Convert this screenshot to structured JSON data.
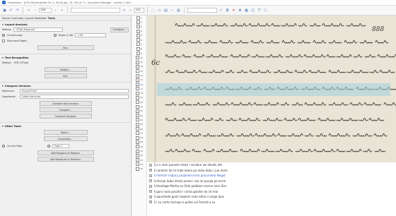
{
  "window": {
    "title": "Transkribus - [UTG-56] Kartoteka 50 / s. 56-lbi.jpg - 01 / 56 (nr 7) - Document Manager - version 1.18.0"
  },
  "toolbar": {
    "page_label": "1/56",
    "zoom": "100"
  },
  "left_panel": {
    "header": "Server Overview, Layout Metadata",
    "header_bold": "Tools",
    "layout": {
      "title": "Layout Analysis",
      "method_label": "Method:",
      "method_value": "CITlab Advanced",
      "config_button": "Configure...",
      "current_page_label": "Current page",
      "pages_label": "Pages (1-56)",
      "pages_value": "1-56",
      "document_label": "Document Pages",
      "run_button": "Run"
    },
    "text_recognition": {
      "title": "Text Recognition",
      "method_label": "Method:",
      "method_value": "HTR (CITlab)",
      "models_button": "Models...",
      "run_button": "Run"
    },
    "compare": {
      "title": "Compare Versions",
      "reference_label": "Reference:",
      "reference_value": "Ground Truth",
      "hypothesis_label": "Hypothesis:",
      "hypothesis_value": "Latest transcript",
      "compare_button": "Compare text versions",
      "advanced_button": "Compare...",
      "samples_button": "Compare Samples"
    },
    "other": {
      "title": "Other Tools",
      "unknown_button": "Tables...",
      "dup_button": "Duplicates...",
      "scope_label": "Current Page",
      "scope_value": "Page 1",
      "polygons_button": "Add Polygons to Regions",
      "baselines_button": "Add Baselines to Textlines"
    }
  },
  "line_numbers": [
    "1",
    "2",
    "3",
    "4",
    "5",
    "6",
    "7",
    "8",
    "9",
    "10",
    "11",
    "12",
    "13",
    "14",
    "15",
    "16",
    "17",
    "18",
    "19",
    "20",
    "21",
    "22",
    "23",
    "24",
    "25",
    "26",
    "27",
    "28",
    "29",
    "30",
    "31",
    "32",
    "33",
    "34",
    "35"
  ],
  "transcript_lines": [
    "§ a u stari parneki miste i sesidun we stiseki oth",
    "§ nareklin ite te tribe dolno po stalo dubu i juo mom",
    "§ mertich majory projoned orma pracurama Negut",
    "§ Heroja dubu drieki panta i rao ne paraja po ornm",
    "§ thestage Martia ne Stile poddam morne aine Gler",
    "§ gurs nuila posaha i canta gandar do sit mai",
    "§ apurmeek gout mapeiro nata ataro i Lenga Jasa",
    "§ i su carta turnepo a pideo sol Fromdi a ns"
  ],
  "manuscript": {
    "page_number": "888",
    "line_markers": [
      "6c",
      "",
      "",
      "",
      "",
      "",
      "",
      ""
    ]
  }
}
